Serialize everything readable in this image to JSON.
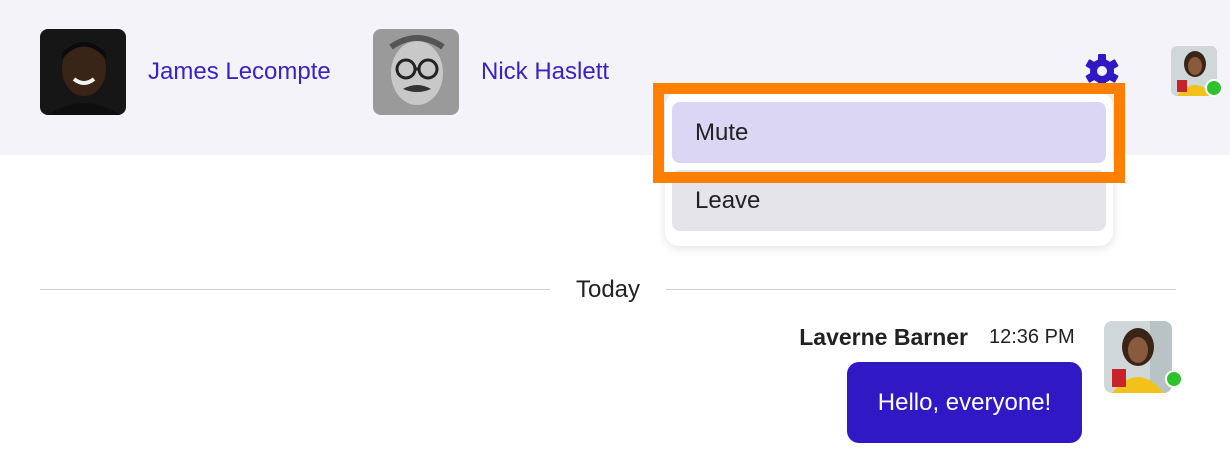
{
  "header": {
    "members": [
      {
        "name": "James Lecompte",
        "avatar_icon": "person-photo-dark"
      },
      {
        "name": "Nick Haslett",
        "avatar_icon": "person-photo-glasses-mask"
      }
    ],
    "settings_icon": "gear-icon",
    "current_user": {
      "avatar_icon": "person-photo-yellow",
      "status": "online"
    }
  },
  "menu": {
    "items": [
      {
        "label": "Mute",
        "state": "hovered"
      },
      {
        "label": "Leave"
      }
    ]
  },
  "chat": {
    "day_divider": "Today",
    "messages": [
      {
        "sender": "Laverne Barner",
        "time": "12:36 PM",
        "text": "Hello, everyone!",
        "avatar_status": "online"
      }
    ]
  },
  "colors": {
    "accent": "#3118c5",
    "link": "#3b22c3",
    "header_bg": "#f4f3fa",
    "highlight": "#ff8000",
    "online": "#2ec22e"
  }
}
